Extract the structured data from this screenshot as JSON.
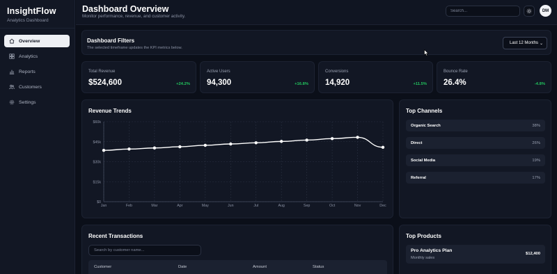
{
  "app": {
    "title": "InsightFlow",
    "subtitle": "Analytics Dashboard"
  },
  "sidebar": {
    "items": [
      {
        "label": "Overview",
        "icon": "home-icon",
        "active": true
      },
      {
        "label": "Analytics",
        "icon": "grid-icon",
        "active": false
      },
      {
        "label": "Reports",
        "icon": "bar-chart-icon",
        "active": false
      },
      {
        "label": "Customers",
        "icon": "users-icon",
        "active": false
      },
      {
        "label": "Settings",
        "icon": "gear-icon",
        "active": false
      }
    ]
  },
  "header": {
    "title": "Dashboard Overview",
    "subtitle": "Monitor performance, revenue, and customer activity.",
    "search_placeholder": "Search...",
    "theme_icon": "sun-icon",
    "avatar_initials": "DM"
  },
  "filters": {
    "title": "Dashboard Filters",
    "subtitle": "The selected timeframe updates the KPI metrics below.",
    "timeframe": "Last 12 Months"
  },
  "kpis": [
    {
      "label": "Total Revenue",
      "value": "$524,600",
      "delta": "+24.2%",
      "trend": "up"
    },
    {
      "label": "Active Users",
      "value": "94,300",
      "delta": "+16.8%",
      "trend": "up"
    },
    {
      "label": "Conversions",
      "value": "14,920",
      "delta": "+11.5%",
      "trend": "up"
    },
    {
      "label": "Bounce Rate",
      "value": "26.4%",
      "delta": "-4.8%",
      "trend": "down"
    }
  ],
  "colors": {
    "positive": "#22c55e",
    "negative": "#22c55e",
    "accent": "#ffffff",
    "background": "#0b0f19",
    "card": "#121724"
  },
  "revenue_card": {
    "title": "Revenue Trends"
  },
  "chart_data": {
    "type": "line",
    "title": "Revenue Trends",
    "xlabel": "",
    "ylabel": "",
    "categories": [
      "Jan",
      "Feb",
      "Mar",
      "Apr",
      "May",
      "Jun",
      "Jul",
      "Aug",
      "Sep",
      "Oct",
      "Nov",
      "Dec"
    ],
    "series": [
      {
        "values": [
          38500,
          39500,
          40300,
          41200,
          42300,
          43300,
          44200,
          45200,
          46200,
          47300,
          48300,
          40800
        ]
      }
    ],
    "y_ticks": [
      "$0",
      "$15k",
      "$30k",
      "$45k",
      "$60k"
    ],
    "ylim": [
      0,
      60000
    ],
    "grid": true,
    "legend": "none"
  },
  "channels": {
    "title": "Top Channels",
    "items": [
      {
        "name": "Organic Search",
        "pct": "38%"
      },
      {
        "name": "Direct",
        "pct": "26%"
      },
      {
        "name": "Social Media",
        "pct": "19%"
      },
      {
        "name": "Referral",
        "pct": "17%"
      }
    ]
  },
  "transactions": {
    "title": "Recent Transactions",
    "search_placeholder": "Search by customer name...",
    "columns": [
      "Customer",
      "Date",
      "Amount",
      "Status"
    ]
  },
  "products": {
    "title": "Top Products",
    "items": [
      {
        "name": "Pro Analytics Plan",
        "sub": "Monthly sales",
        "price": "$12,400"
      }
    ]
  }
}
